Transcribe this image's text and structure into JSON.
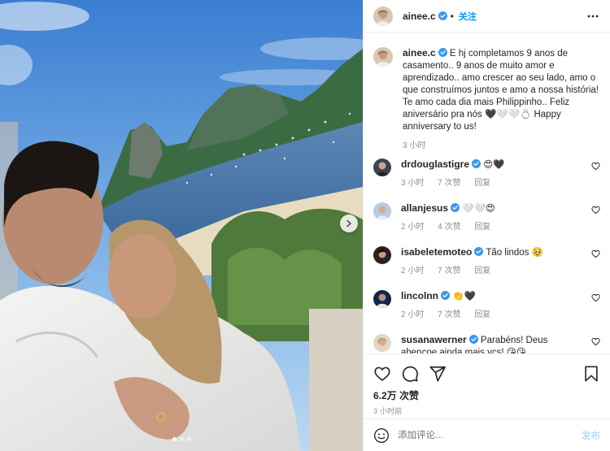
{
  "photo": {
    "description_icon": "couple-photo",
    "carousel_dots": 3,
    "active_dot": 0
  },
  "post": {
    "author": "ainee.c",
    "follow_label": "关注",
    "caption": "E hj completamos 9 anos de casamento.. 9 anos de muito amor e aprendizado.. amo crescer ao seu lado, amo o que construímos juntos e amo a nossa história! Te amo cada dia mais Philippinho.. Feliz aniversário pra nós 🖤🤍🤍💍 Happy anniversary to us!",
    "caption_time": "3 小时"
  },
  "comments": [
    {
      "user": "drdouglastigre",
      "verified": true,
      "text": "😍🖤",
      "time": "3 小时",
      "likes": "7 次赞",
      "reply": "回复"
    },
    {
      "user": "allanjesus",
      "verified": true,
      "text": "🤍🤍😍",
      "time": "2 小时",
      "likes": "4 次赞",
      "reply": "回复"
    },
    {
      "user": "isabeletemoteo",
      "verified": true,
      "text": "Tão lindos 🥹",
      "time": "2 小时",
      "likes": "7 次赞",
      "reply": "回复"
    },
    {
      "user": "lincolnn",
      "verified": true,
      "text": "👏🖤",
      "time": "2 小时",
      "likes": "7 次赞",
      "reply": "回复"
    },
    {
      "user": "susanawerner",
      "verified": true,
      "text": "Parabéns! Deus abençoe ainda mais vcs! 😘😘",
      "time": "",
      "likes": "",
      "reply": ""
    }
  ],
  "stats": {
    "likes": "6.2万 次赞",
    "posted": "3 小时前"
  },
  "composer": {
    "placeholder": "添加评论...",
    "post_label": "发布"
  },
  "colors": {
    "accent": "#0095f6",
    "verified": "#3897f0",
    "muted": "#8e8e8e",
    "post_disabled": "#b2dffc"
  }
}
